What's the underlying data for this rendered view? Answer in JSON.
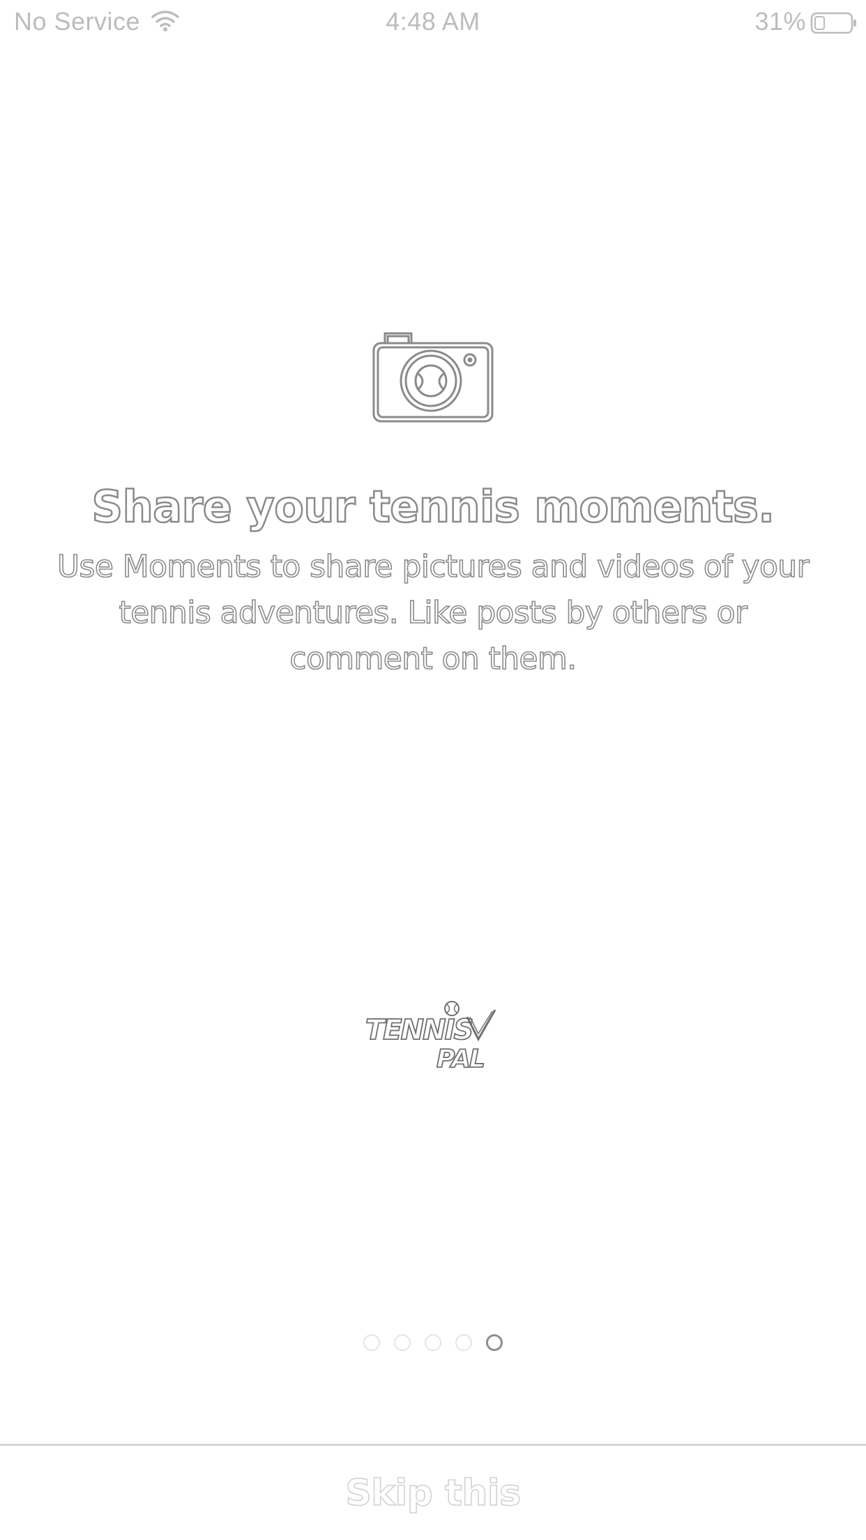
{
  "status_bar": {
    "carrier": "No Service",
    "time": "4:48 AM",
    "battery_percent": "31%",
    "icons": [
      "wifi-icon",
      "battery-icon"
    ]
  },
  "slide": {
    "icon": "camera-icon",
    "title": "Share your tennis moments.",
    "description": "Use Moments to share pictures and videos of your tennis adventures. Like posts by others or comment on them."
  },
  "logo": {
    "line1": "TENNIS",
    "line2": "PAL"
  },
  "pagination": {
    "total": 5,
    "current": 5
  },
  "footer": {
    "skip_label": "Skip this"
  },
  "colors": {
    "outline": "#8a8a8a",
    "muted": "#bcbcbc",
    "background": "#ffffff"
  }
}
